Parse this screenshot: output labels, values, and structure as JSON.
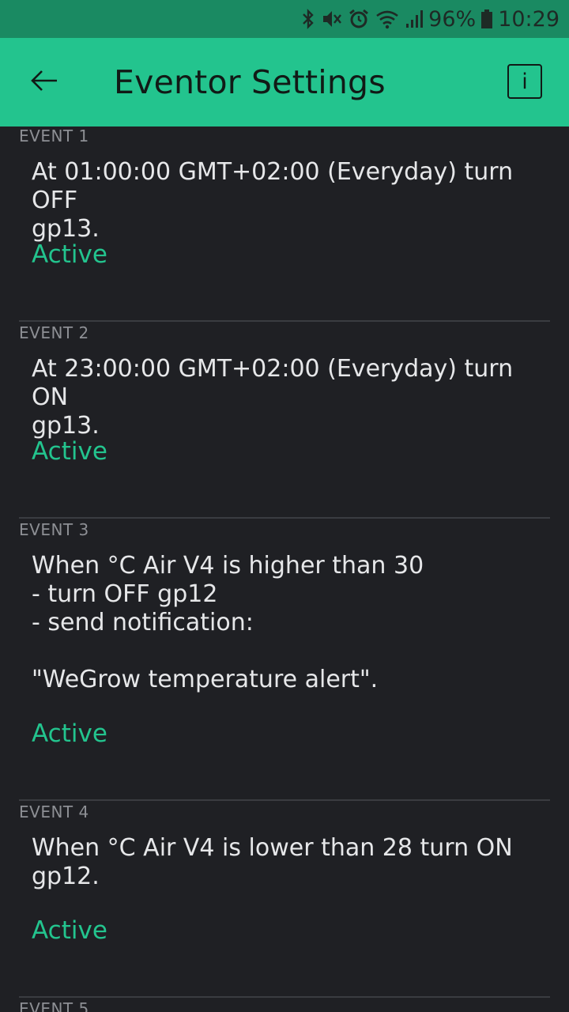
{
  "status_bar": {
    "battery": "96%",
    "time": "10:29",
    "icons": [
      "bluetooth-icon",
      "mute-icon",
      "alarm-icon",
      "wifi-icon",
      "signal-icon",
      "battery-icon"
    ]
  },
  "app_bar": {
    "title": "Eventor Settings",
    "back_icon": "arrow-left-icon",
    "info_label": "i"
  },
  "colors": {
    "accent": "#23c48e",
    "status_bar": "#1a8a62",
    "background": "#1f2024"
  },
  "events": [
    {
      "header": "EVENT 1",
      "description": "At 01:00:00 GMT+02:00 (Everyday) turn OFF\ngp13.",
      "status": "Active"
    },
    {
      "header": "EVENT 2",
      "description": "At 23:00:00 GMT+02:00 (Everyday) turn ON\ngp13.",
      "status": "Active"
    },
    {
      "header": "EVENT 3",
      "description": "When °C Air V4 is higher than 30\n- turn OFF gp12\n- send notification:\n\n\"WeGrow temperature alert\".",
      "status": "Active"
    },
    {
      "header": "EVENT 4",
      "description": "When °C Air V4 is lower than 28 turn ON\ngp12.",
      "status": "Active"
    },
    {
      "header": "EVENT 5"
    }
  ]
}
